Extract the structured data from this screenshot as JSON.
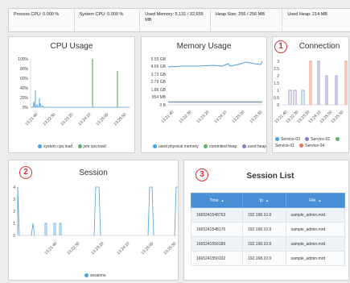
{
  "status": {
    "process_cpu": "Process CPU: 0.000 %",
    "system_cpu": "System CPU: 0.000 %",
    "used_memory": "Used Memory: 5,131 / 32,655 MB",
    "heap_size": "Heap Size: 256 / 256 MB",
    "used_heap": "Used Heap: 214 MB"
  },
  "colors": {
    "blue": "#4aa0d8",
    "green": "#59b46c",
    "purple": "#8a78c8",
    "orange": "#e2735a",
    "marker": "#d93030"
  },
  "charts": {
    "cpu": {
      "title": "CPU Usage",
      "x_ticks": [
        "13:21:40",
        "13:22:30",
        "13:23:20",
        "13:24:10",
        "13:25:00",
        "13:25:50"
      ],
      "y_ticks": [
        "100%",
        "80%",
        "60%",
        "40%",
        "20%",
        "0%"
      ],
      "legend": [
        "system cpu load",
        "jvm cpu load"
      ]
    },
    "memory": {
      "title": "Memory Usage",
      "x_ticks": [
        "13:21:40",
        "13:22:30",
        "13:23:20",
        "13:24:10",
        "13:25:00",
        "13:25:50"
      ],
      "y_ticks": [
        "5.59 GB",
        "4.66 GB",
        "3.73 GB",
        "2.79 GB",
        "1.86 GB",
        "954 MB",
        "0 B"
      ],
      "legend": [
        "used physical memory",
        "commited heap",
        "used heap"
      ]
    },
    "connection": {
      "marker": "1",
      "title": "Connection",
      "x_ticks": [
        "13:21:40",
        "13:22:30",
        "13:23:20",
        "13:24:10",
        "13:25:00",
        "13:25:50"
      ],
      "y_ticks": [
        "3",
        "2.5",
        "2",
        "1.5",
        "1",
        "0.5",
        "0"
      ],
      "legend": [
        "Service-03",
        "Service-02",
        "Service-01",
        "Service-04"
      ]
    },
    "session": {
      "marker": "2",
      "title": "Session",
      "x_ticks": [
        "13:21:40",
        "13:22:30",
        "13:23:20",
        "13:24:10",
        "13:25:00",
        "13:25:50"
      ],
      "y_ticks": [
        "4",
        "3",
        "2",
        "1",
        "0"
      ],
      "legend": [
        "sessions"
      ]
    }
  },
  "session_list": {
    "marker": "3",
    "title": "Session List",
    "columns": [
      "Time",
      "Ip",
      "File"
    ],
    "rows": [
      [
        "1665241548763",
        "192.168.10.9",
        "sample_admin.mrd"
      ],
      [
        "1665241548176",
        "192.168.10.9",
        "sample_admin.mrd"
      ],
      [
        "1665241550189",
        "192.168.10.9",
        "sample_admin.mrd"
      ],
      [
        "1665241550102",
        "192.168.10.9",
        "sample_admin.mrd"
      ]
    ]
  }
}
